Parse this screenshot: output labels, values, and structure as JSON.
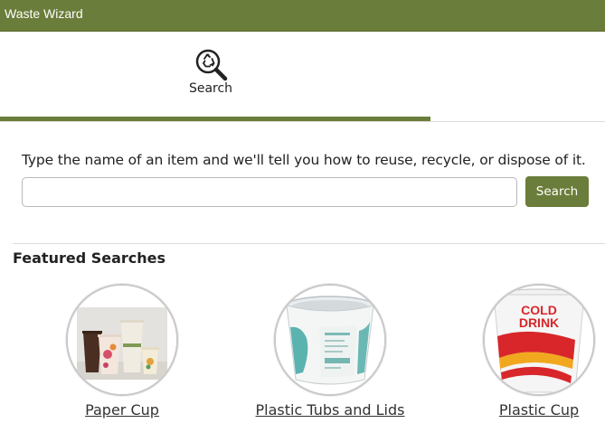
{
  "app": {
    "title": "Waste Wizard"
  },
  "tabs": [
    {
      "label": "Search",
      "icon": "recycle-search-icon",
      "active": true
    }
  ],
  "search": {
    "instruction": "Type the name of an item and we'll tell you how to reuse, recycle, or dispose of it.",
    "value": "",
    "placeholder": "",
    "button_label": "Search"
  },
  "featured": {
    "heading": "Featured Searches",
    "items": [
      {
        "label": "Paper Cup",
        "image": "paper-cups-image"
      },
      {
        "label": "Plastic Tubs and Lids",
        "image": "plastic-tub-image"
      },
      {
        "label": "Plastic Cup",
        "image": "plastic-cup-image",
        "image_text": "COLD DRINK"
      }
    ]
  },
  "colors": {
    "brand": "#6b7d3a",
    "divider": "#dcdcdc"
  }
}
